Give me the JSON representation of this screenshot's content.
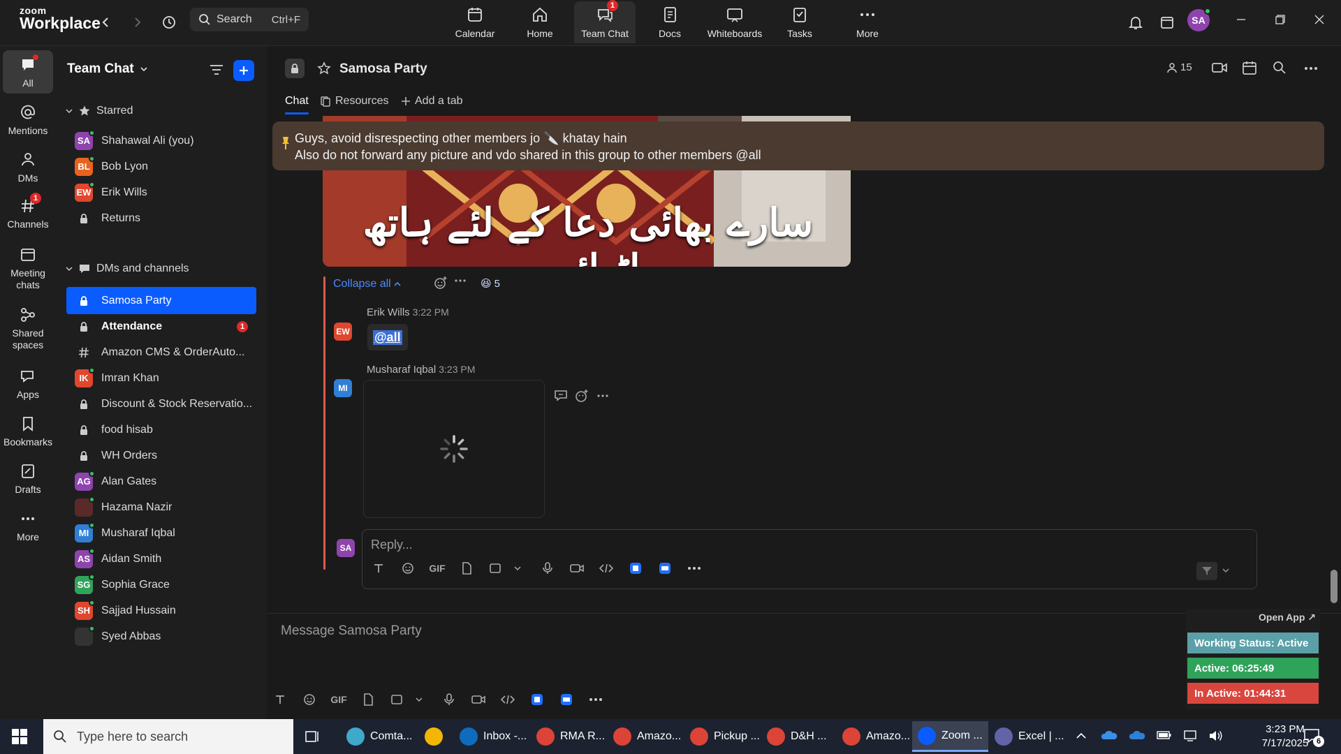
{
  "app": {
    "logo_line1": "zoom",
    "logo_line2": "Workplace"
  },
  "search": {
    "label": "Search",
    "shortcut": "Ctrl+F"
  },
  "nav_tabs": [
    {
      "label": "Calendar"
    },
    {
      "label": "Home"
    },
    {
      "label": "Team Chat",
      "badge": "1"
    },
    {
      "label": "Docs"
    },
    {
      "label": "Whiteboards"
    },
    {
      "label": "Tasks"
    },
    {
      "label": "More"
    }
  ],
  "user": {
    "initials": "SA"
  },
  "rail": [
    {
      "label": "All"
    },
    {
      "label": "Mentions"
    },
    {
      "label": "DMs"
    },
    {
      "label": "Channels",
      "badge": "1"
    },
    {
      "label": "Meeting chats"
    },
    {
      "label": "Shared spaces"
    },
    {
      "label": "Apps"
    },
    {
      "label": "Bookmarks"
    },
    {
      "label": "Drafts"
    },
    {
      "label": "More"
    }
  ],
  "sidebar": {
    "title": "Team Chat",
    "starred_label": "Starred",
    "starred": [
      {
        "initials": "SA",
        "name": "Shahawal Ali (you)",
        "color": "#8e44ad"
      },
      {
        "initials": "BL",
        "name": "Bob Lyon",
        "color": "#e8631f"
      },
      {
        "initials": "EW",
        "name": "Erik Wills",
        "color": "#e0472e"
      },
      {
        "name": "Returns",
        "glyph": "lock"
      }
    ],
    "dms_label": "DMs and channels",
    "dms": [
      {
        "name": "Samosa Party",
        "glyph": "lock",
        "active": true
      },
      {
        "name": "Attendance",
        "glyph": "lock",
        "bold": true,
        "badge": "1"
      },
      {
        "name": "Amazon CMS & OrderAuto...",
        "glyph": "hash"
      },
      {
        "initials": "IK",
        "name": "Imran Khan",
        "color": "#e0472e"
      },
      {
        "name": "Discount & Stock Reservatio...",
        "glyph": "lock"
      },
      {
        "name": "food hisab",
        "glyph": "lock"
      },
      {
        "name": "WH Orders",
        "glyph": "lock"
      },
      {
        "initials": "AG",
        "name": "Alan Gates",
        "color": "#8e44ad"
      },
      {
        "initials": "",
        "name": "Hazama Nazir",
        "color": "#5a2a2a"
      },
      {
        "initials": "MI",
        "name": "Musharaf Iqbal",
        "color": "#2f7fd6"
      },
      {
        "initials": "AS",
        "name": "Aidan Smith",
        "color": "#8e44ad"
      },
      {
        "initials": "SG",
        "name": "Sophia Grace",
        "color": "#2fa35a"
      },
      {
        "initials": "SH",
        "name": "Sajjad Hussain",
        "color": "#e0472e"
      },
      {
        "initials": "",
        "name": "Syed Abbas",
        "color": "#333333"
      }
    ]
  },
  "channel": {
    "name": "Samosa Party",
    "member_count": "15",
    "tabs": [
      {
        "label": "Chat"
      },
      {
        "label": "Resources"
      },
      {
        "label": "Add a tab"
      }
    ]
  },
  "pinned": {
    "line1": "Guys, avoid disrespecting other members jo 🔪 khatay hain",
    "line2": "Also do not forward any picture and vdo shared in this group to other members @all"
  },
  "image_caption": "سارے بھائی دعا کے لئے ہاتھ اٹھائیں",
  "thread": {
    "collapse_label": "Collapse all",
    "reaction_emoji": "😆",
    "reaction_count": "5",
    "messages": [
      {
        "initials": "EW",
        "author": "Erik Wills",
        "time": "3:22 PM",
        "text": "@all",
        "color": "#e0472e"
      },
      {
        "initials": "MI",
        "author": "Musharaf Iqbal",
        "time": "3:23 PM",
        "color": "#2f7fd6"
      }
    ],
    "reply_initials": "SA",
    "reply_placeholder": "Reply..."
  },
  "composer": {
    "placeholder": "Message Samosa Party"
  },
  "format_gif": "GIF",
  "status_widget": {
    "open_app": "Open App ↗",
    "working_status": "Working Status: Active",
    "active": "Active: 06:25:49",
    "inactive": "In Active: 01:44:31"
  },
  "taskbar": {
    "search_placeholder": "Type here to search",
    "tasks": [
      {
        "label": "Comta...",
        "color": "#3fa9c9"
      },
      {
        "label": "",
        "color": "#f2b705"
      },
      {
        "label": "Inbox -...",
        "color": "#0f6cbd"
      },
      {
        "label": "RMA R...",
        "color": "#db4437"
      },
      {
        "label": "Amazo...",
        "color": "#db4437"
      },
      {
        "label": "Pickup ...",
        "color": "#db4437"
      },
      {
        "label": "D&H ...",
        "color": "#db4437"
      },
      {
        "label": "Amazo...",
        "color": "#db4437"
      },
      {
        "label": "Zoom ...",
        "color": "#0b5cff"
      },
      {
        "label": "Excel | ...",
        "color": "#6264a7"
      }
    ],
    "time": "3:23 PM",
    "date": "7/17/2025",
    "notif_count": "6"
  }
}
